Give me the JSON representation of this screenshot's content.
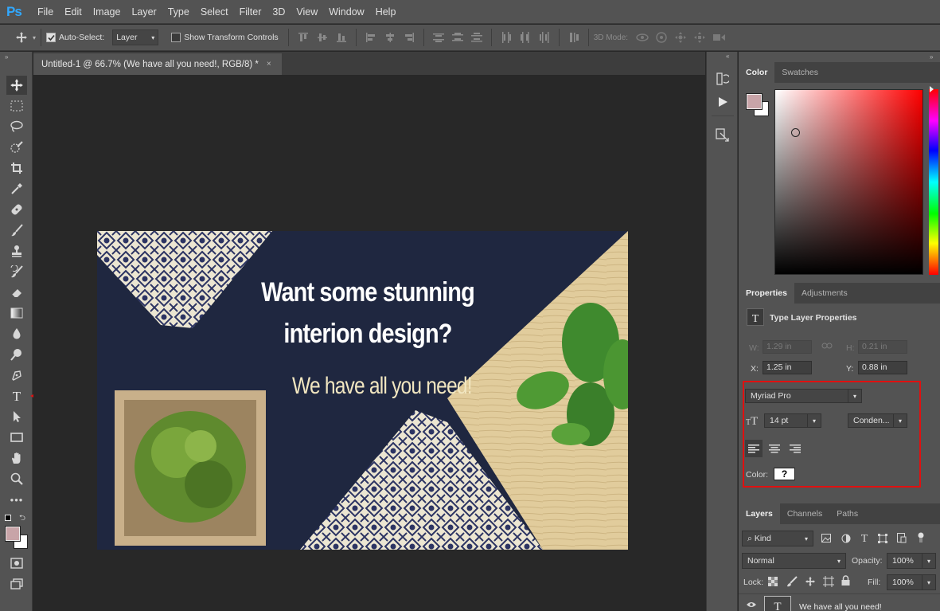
{
  "app": {
    "logo": "Ps"
  },
  "menu": [
    "File",
    "Edit",
    "Image",
    "Layer",
    "Type",
    "Select",
    "Filter",
    "3D",
    "View",
    "Window",
    "Help"
  ],
  "options": {
    "auto_select_label": "Auto-Select:",
    "auto_select_value": "Layer",
    "show_transform_label": "Show Transform Controls",
    "mode_3d_label": "3D Mode:"
  },
  "document": {
    "tab_title": "Untitled-1 @ 66.7% (We have all you need!, RGB/8) *",
    "close_glyph": "×"
  },
  "artwork": {
    "headline_line1": "Want some stunning",
    "headline_line2": "interion design?",
    "tagline": "We have all you need!"
  },
  "color_panel": {
    "tabs": [
      "Color",
      "Swatches"
    ],
    "active_tab": "Color",
    "foreground": "#c8a4a8",
    "background": "#ffffff"
  },
  "properties_panel": {
    "tabs": [
      "Properties",
      "Adjustments"
    ],
    "section_title": "Type Layer Properties",
    "w_label": "W:",
    "w_value": "1.29 in",
    "h_label": "H:",
    "h_value": "0.21 in",
    "x_label": "X:",
    "x_value": "1.25 in",
    "y_label": "Y:",
    "y_value": "0.88 in",
    "font_family": "Myriad Pro",
    "font_size": "14 pt",
    "font_style": "Conden...",
    "color_label": "Color:",
    "color_value": "?"
  },
  "layers_panel": {
    "tabs": [
      "Layers",
      "Channels",
      "Paths"
    ],
    "filter_kind": "Kind",
    "blend_mode": "Normal",
    "opacity_label": "Opacity:",
    "opacity_value": "100%",
    "lock_label": "Lock:",
    "fill_label": "Fill:",
    "fill_value": "100%",
    "layer_name": "We have all you need!"
  },
  "annotation": {
    "arrow_color": "#e01010",
    "highlight_color": "#e01010"
  }
}
